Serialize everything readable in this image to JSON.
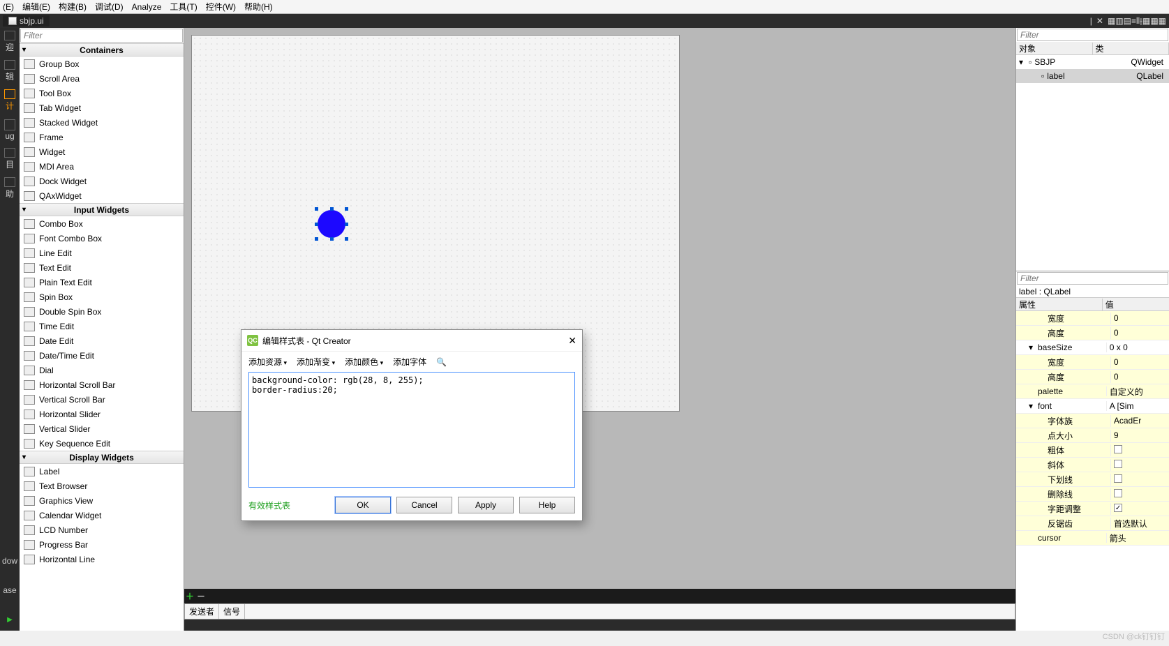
{
  "menus": [
    "(E)",
    "编辑(E)",
    "构建(B)",
    "调试(D)",
    "Analyze",
    "工具(T)",
    "控件(W)",
    "帮助(H)"
  ],
  "file_tab": "sbjp.ui",
  "modebar": [
    {
      "label": "迎"
    },
    {
      "label": "辑"
    },
    {
      "label": "计",
      "active": true
    },
    {
      "label": "ug"
    },
    {
      "label": "目"
    },
    {
      "label": "助"
    },
    {
      "label": "dow"
    },
    {
      "label": "ase"
    }
  ],
  "widgetbox": {
    "filter_placeholder": "Filter",
    "groups": [
      {
        "title": "Containers",
        "items": [
          "Group Box",
          "Scroll Area",
          "Tool Box",
          "Tab Widget",
          "Stacked Widget",
          "Frame",
          "Widget",
          "MDI Area",
          "Dock Widget",
          "QAxWidget"
        ]
      },
      {
        "title": "Input Widgets",
        "items": [
          "Combo Box",
          "Font Combo Box",
          "Line Edit",
          "Text Edit",
          "Plain Text Edit",
          "Spin Box",
          "Double Spin Box",
          "Time Edit",
          "Date Edit",
          "Date/Time Edit",
          "Dial",
          "Horizontal Scroll Bar",
          "Vertical Scroll Bar",
          "Horizontal Slider",
          "Vertical Slider",
          "Key Sequence Edit"
        ]
      },
      {
        "title": "Display Widgets",
        "items": [
          "Label",
          "Text Browser",
          "Graphics View",
          "Calendar Widget",
          "LCD Number",
          "Progress Bar",
          "Horizontal Line"
        ]
      }
    ]
  },
  "sigslot": {
    "add": "＋",
    "remove": "－",
    "cols": [
      "发送者",
      "信号"
    ]
  },
  "object_inspector": {
    "filter_placeholder": "Filter",
    "cols": [
      "对象",
      "类"
    ],
    "rows": [
      {
        "name": "SBJP",
        "cls": "QWidget",
        "depth": 0,
        "expand": "▾"
      },
      {
        "name": "label",
        "cls": "QLabel",
        "depth": 1,
        "selected": true
      }
    ]
  },
  "property_editor": {
    "filter_placeholder": "Filter",
    "title": "label : QLabel",
    "cols": [
      "属性",
      "值"
    ],
    "rows": [
      {
        "name": "宽度",
        "val": "0",
        "indent": 2,
        "sub": true
      },
      {
        "name": "高度",
        "val": "0",
        "indent": 2,
        "sub": true
      },
      {
        "name": "baseSize",
        "val": "0 x 0",
        "indent": 1,
        "expand": "▾"
      },
      {
        "name": "宽度",
        "val": "0",
        "indent": 2,
        "sub": true
      },
      {
        "name": "高度",
        "val": "0",
        "indent": 2,
        "sub": true
      },
      {
        "name": "palette",
        "val": "自定义的",
        "indent": 1,
        "sub": true
      },
      {
        "name": "font",
        "val": "A [Sim",
        "indent": 1,
        "expand": "▾"
      },
      {
        "name": "字体族",
        "val": "AcadEr",
        "indent": 2,
        "sub": true
      },
      {
        "name": "点大小",
        "val": "9",
        "indent": 2,
        "sub": true
      },
      {
        "name": "粗体",
        "val": "",
        "indent": 2,
        "sub": true,
        "check": false
      },
      {
        "name": "斜体",
        "val": "",
        "indent": 2,
        "sub": true,
        "check": false
      },
      {
        "name": "下划线",
        "val": "",
        "indent": 2,
        "sub": true,
        "check": false
      },
      {
        "name": "删除线",
        "val": "",
        "indent": 2,
        "sub": true,
        "check": false
      },
      {
        "name": "字距调整",
        "val": "",
        "indent": 2,
        "sub": true,
        "check": true
      },
      {
        "name": "反锯齿",
        "val": "首选默认",
        "indent": 2,
        "sub": true
      },
      {
        "name": "cursor",
        "val": "箭头",
        "indent": 1,
        "sub": true
      }
    ]
  },
  "dialog": {
    "title": "编辑样式表 - Qt Creator",
    "menus": [
      "添加资源",
      "添加渐变",
      "添加颜色",
      "添加字体"
    ],
    "code": "background-color: rgb(28, 8, 255);\nborder-radius:20;",
    "valid": "有效样式表",
    "ok": "OK",
    "cancel": "Cancel",
    "apply": "Apply",
    "help": "Help"
  },
  "watermark": "CSDN @ck钉钉钉"
}
